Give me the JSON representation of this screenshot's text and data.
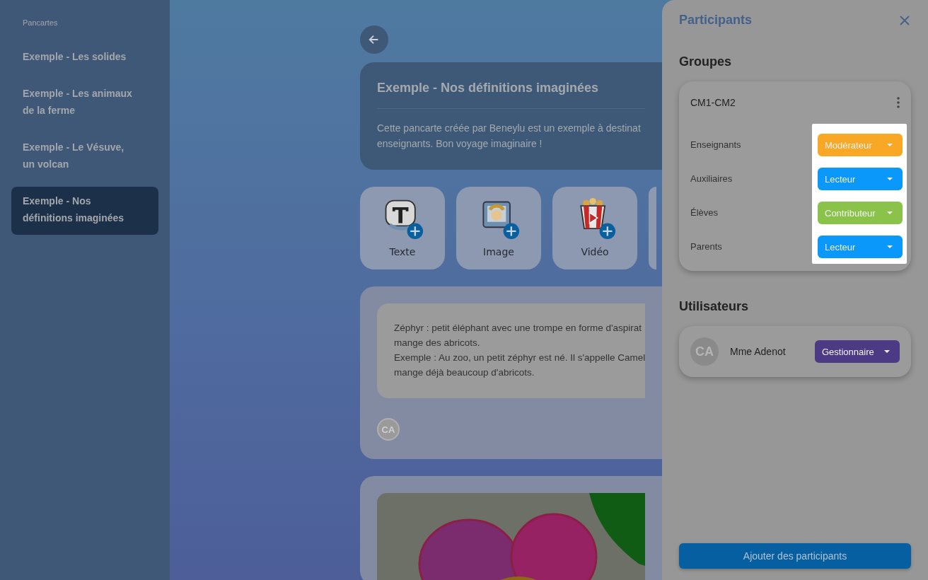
{
  "sidebar": {
    "heading": "Pancartes",
    "items": [
      {
        "label": "Exemple - Les solides",
        "selected": false
      },
      {
        "label": "Exemple - Les animaux de la ferme",
        "selected": false
      },
      {
        "label": "Exemple - Le Vésuve, un volcan",
        "selected": false
      },
      {
        "label": "Exemple - Nos définitions imaginées",
        "selected": true
      }
    ]
  },
  "board": {
    "title": "Exemple - Nos définitions imaginées",
    "description_lines": [
      "Cette pancarte créée par Beneylu est un exemple à destinat",
      "enseignants. Bon voyage imaginaire !"
    ]
  },
  "tiles": [
    {
      "kind": "text",
      "label": "Texte"
    },
    {
      "kind": "image",
      "label": "Image"
    },
    {
      "kind": "video",
      "label": "Vidéo"
    },
    {
      "kind": "other"
    }
  ],
  "posts": [
    {
      "kind": "text",
      "lines": [
        "Zéphyr : petit éléphant avec une trompe en forme d'aspirat",
        "mange des abricots.",
        "Exemple : Au zoo, un petit zéphyr est né. Il s'appelle Camel",
        "mange déjà beaucoup d'abricots."
      ],
      "author_initials": "CA"
    },
    {
      "kind": "image"
    }
  ],
  "panel": {
    "title": "Participants",
    "groups_heading": "Groupes",
    "groups": [
      {
        "name": "CM1-CM2",
        "highlighted": true,
        "roles": [
          {
            "audience": "Enseignants",
            "role": "Modérateur",
            "color": "#f9a825"
          },
          {
            "audience": "Auxiliaires",
            "role": "Lecteur",
            "color": "#0a99fb"
          },
          {
            "audience": "Élèves",
            "role": "Contributeur",
            "color": "#8bc34a"
          },
          {
            "audience": "Parents",
            "role": "Lecteur",
            "color": "#0a99fb"
          }
        ]
      }
    ],
    "users_heading": "Utilisateurs",
    "users": [
      {
        "initials": "CA",
        "name": "Mme Adenot",
        "role": "Gestionnaire",
        "color": "#4d3a85"
      }
    ],
    "add_button": "Ajouter des participants"
  }
}
